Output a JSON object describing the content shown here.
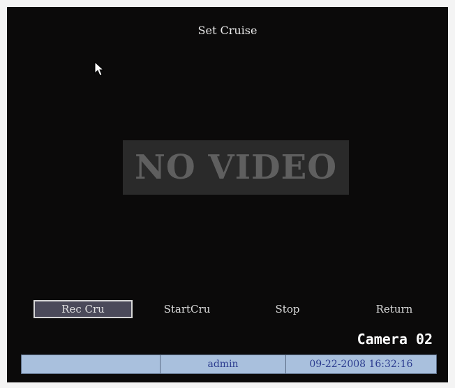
{
  "title": "Set Cruise",
  "video_placeholder": "NO VIDEO",
  "menu": {
    "rec_cru": "Rec Cru",
    "start_cru": "StartCru",
    "stop": "Stop",
    "return": "Return"
  },
  "camera_label": "Camera 02",
  "status_bar": {
    "user": "admin",
    "datetime": "09-22-2008 16:32:16"
  },
  "colors": {
    "screen_bg": "#0b0a0a",
    "status_bar_bg": "#a9c0dd",
    "selected_button_bg": "#4b4a5a",
    "status_text": "#2c3c8f"
  },
  "icons": {
    "cursor": "mouse-pointer-icon"
  }
}
